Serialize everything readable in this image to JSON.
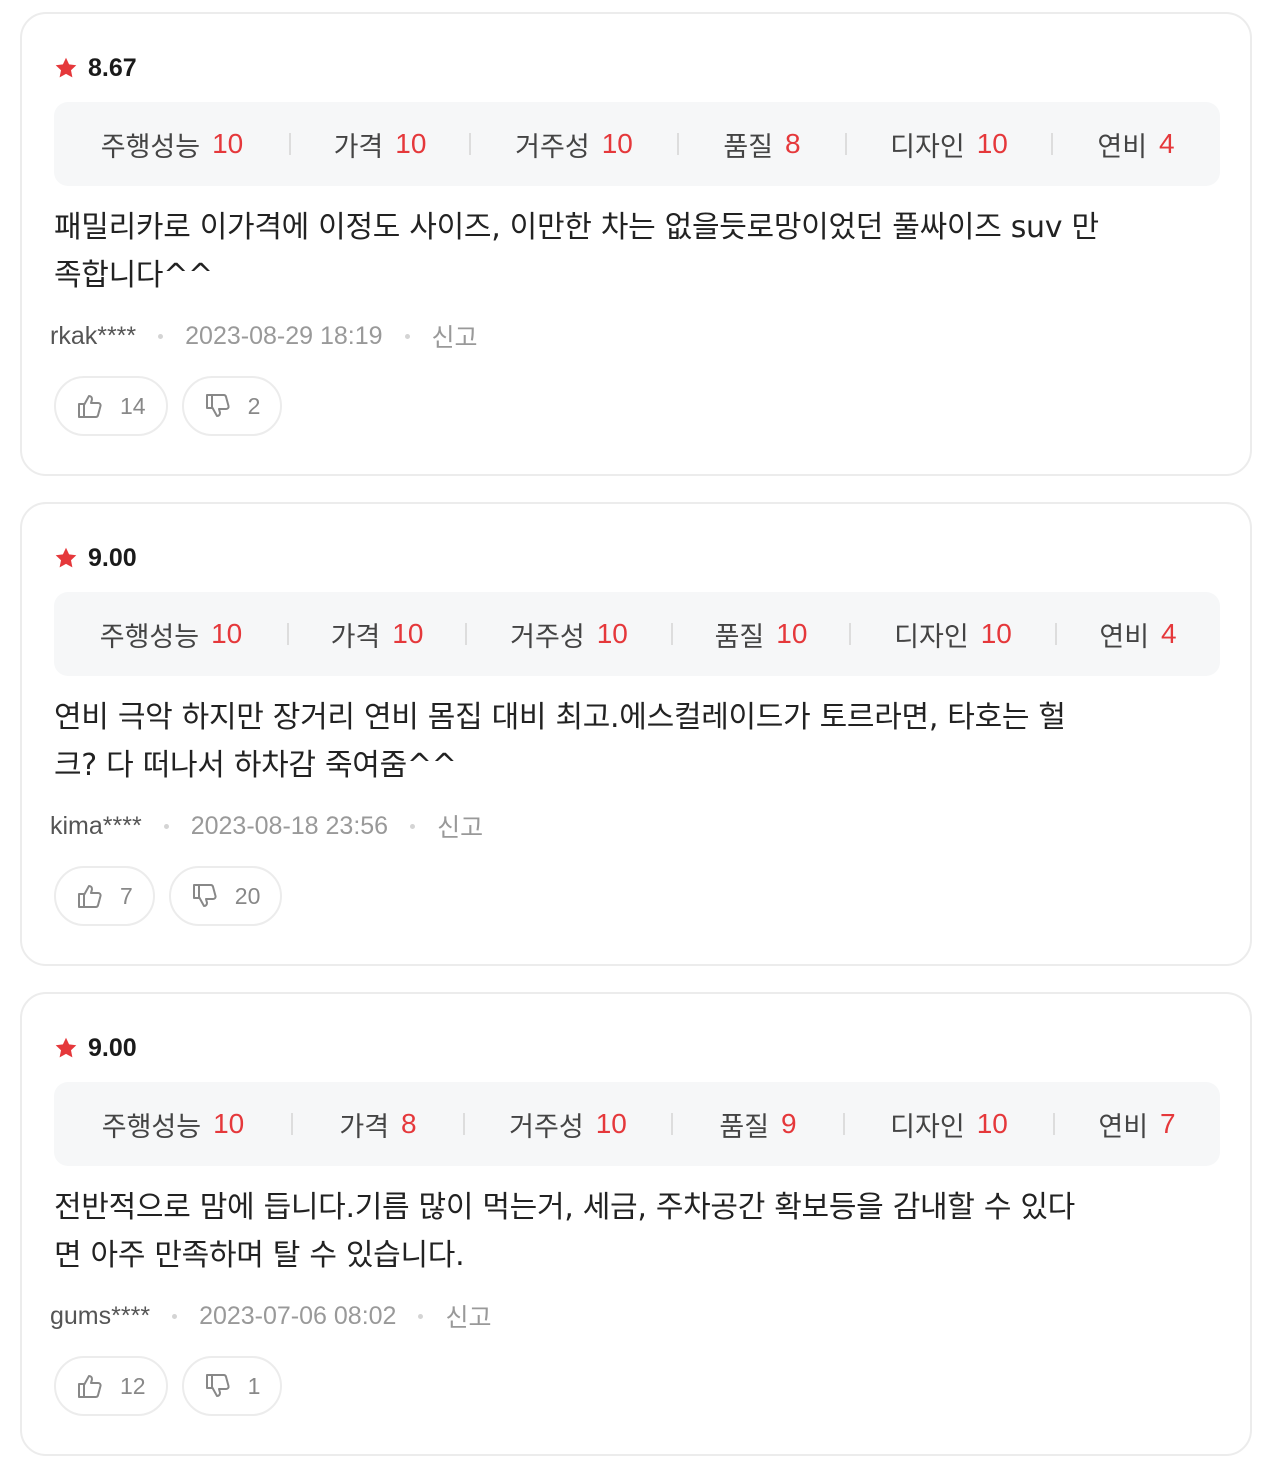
{
  "colors": {
    "accent_red": "#e5383b",
    "card_border": "#ececec",
    "score_bg": "#f6f7f8",
    "meta_gray": "#999999"
  },
  "icons": {
    "rating": "star-icon",
    "like": "thumbs-up-icon",
    "dislike": "thumbs-down-icon"
  },
  "reviews": [
    {
      "rating": "8.67",
      "scores": [
        {
          "label": "주행성능",
          "value": "10"
        },
        {
          "label": "가격",
          "value": "10"
        },
        {
          "label": "거주성",
          "value": "10"
        },
        {
          "label": "품질",
          "value": "8"
        },
        {
          "label": "디자인",
          "value": "10"
        },
        {
          "label": "연비",
          "value": "4"
        }
      ],
      "text_lines": [
        "패밀리카로 이가격에 이정도 사이즈, 이만한 차는 없을듯로망이었던 풀싸이즈 suv 만",
        "족합니다^^"
      ],
      "author": "rkak****",
      "date": "2023-08-29 18:19",
      "report_label": "신고",
      "likes": "14",
      "dislikes": "2"
    },
    {
      "rating": "9.00",
      "scores": [
        {
          "label": "주행성능",
          "value": "10"
        },
        {
          "label": "가격",
          "value": "10"
        },
        {
          "label": "거주성",
          "value": "10"
        },
        {
          "label": "품질",
          "value": "10"
        },
        {
          "label": "디자인",
          "value": "10"
        },
        {
          "label": "연비",
          "value": "4"
        }
      ],
      "text_lines": [
        "연비 극악 하지만 장거리 연비 몸집 대비 최고.에스컬레이드가 토르라면, 타호는 헐",
        "크? 다 떠나서 하차감 죽여줌^^"
      ],
      "author": "kima****",
      "date": "2023-08-18 23:56",
      "report_label": "신고",
      "likes": "7",
      "dislikes": "20"
    },
    {
      "rating": "9.00",
      "scores": [
        {
          "label": "주행성능",
          "value": "10"
        },
        {
          "label": "가격",
          "value": "8"
        },
        {
          "label": "거주성",
          "value": "10"
        },
        {
          "label": "품질",
          "value": "9"
        },
        {
          "label": "디자인",
          "value": "10"
        },
        {
          "label": "연비",
          "value": "7"
        }
      ],
      "text_lines": [
        "전반적으로 맘에 듭니다.기름 많이 먹는거, 세금, 주차공간 확보등을 감내할 수 있다",
        "면 아주 만족하며 탈 수 있습니다."
      ],
      "author": "gums****",
      "date": "2023-07-06 08:02",
      "report_label": "신고",
      "likes": "12",
      "dislikes": "1"
    }
  ]
}
